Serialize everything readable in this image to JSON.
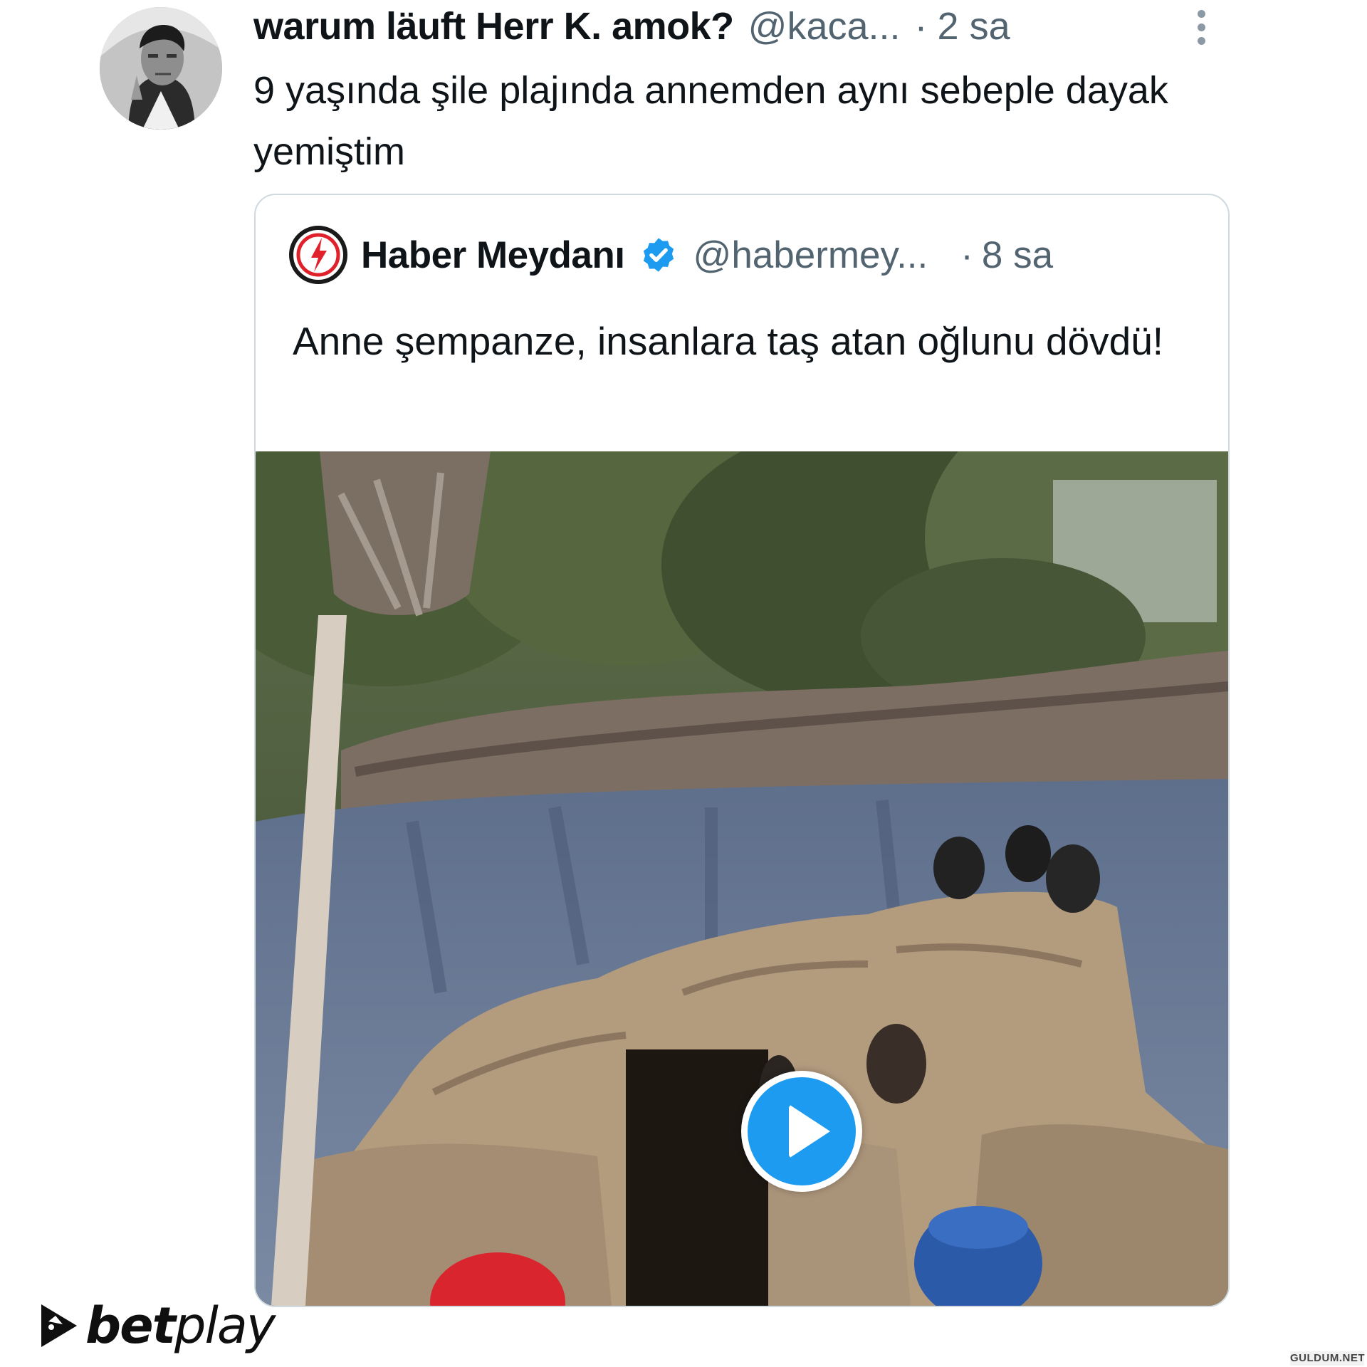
{
  "tweet": {
    "display_name": "warum läuft Herr K. amok?",
    "handle": "@kaca...",
    "separator": "·",
    "time": "2 sa",
    "text": "9 yaşında şile plajında annemden aynı sebeple dayak yemiştim",
    "avatar_icon": "user-avatar-photo",
    "more_icon": "more-vertical-icon"
  },
  "quoted": {
    "display_name": "Haber Meydanı",
    "handle": "@habermey...",
    "separator": "·",
    "time": "8 sa",
    "text": "Anne şempanze, insanlara taş atan oğlunu dövdü!",
    "logo_icon": "lightning-bolt-logo",
    "verified_icon": "verified-badge-icon",
    "media": {
      "type": "video",
      "play_icon": "play-icon"
    }
  },
  "brand": {
    "bold": "bet",
    "light": "play"
  },
  "watermark": {
    "logo_text": "GULDUM.NET"
  },
  "colors": {
    "text_primary": "#0f1419",
    "text_secondary": "#536471",
    "card_border": "#cfd9de",
    "accent_blue": "#1d9bf0",
    "logo_red": "#e0202a"
  }
}
